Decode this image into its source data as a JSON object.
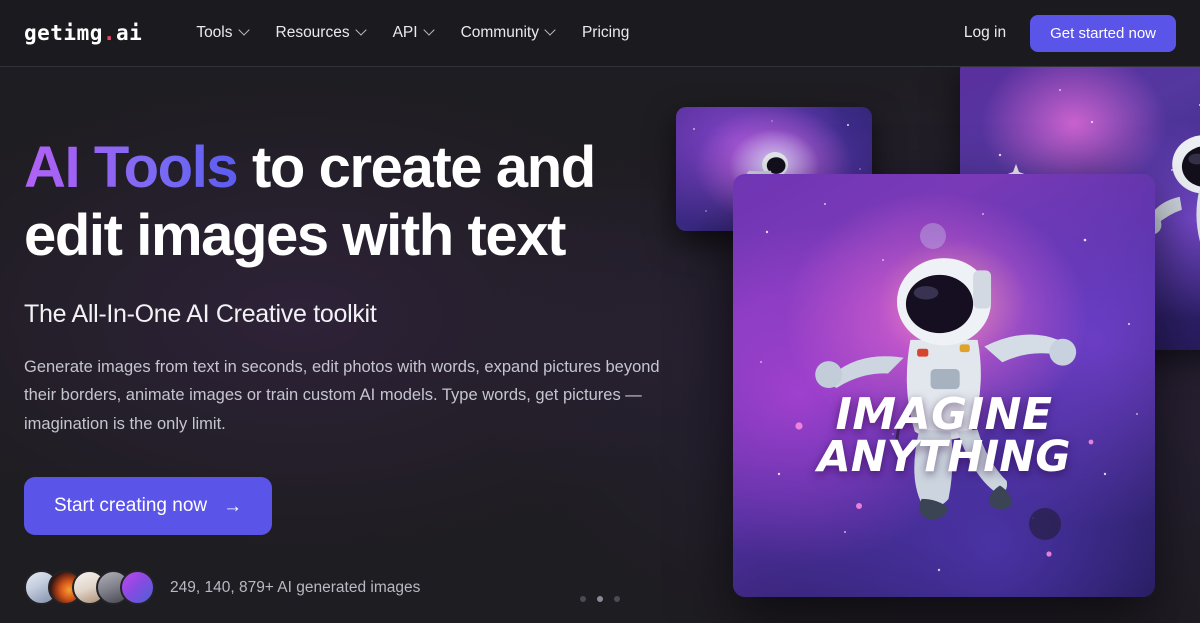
{
  "navbar": {
    "logo": {
      "text": "getimg",
      "dot": ".",
      "suffix": "ai",
      "full": "getimg.ai"
    },
    "links": [
      {
        "label": "Tools",
        "has_chevron": true,
        "icon": "chevron-down-icon"
      },
      {
        "label": "Resources",
        "has_chevron": true,
        "icon": "chevron-down-icon"
      },
      {
        "label": "API",
        "has_chevron": true,
        "icon": "chevron-down-icon"
      },
      {
        "label": "Community",
        "has_chevron": true,
        "icon": "chevron-down-icon"
      },
      {
        "label": "Pricing",
        "has_chevron": false,
        "icon": ""
      }
    ],
    "login_label": "Log in",
    "get_started_label": "Get started now"
  },
  "hero": {
    "headline_highlight": "AI Tools",
    "headline_rest": " to create and edit images with text",
    "subheadline": "The All-In-One AI Creative toolkit",
    "body": "Generate images from text in seconds, edit photos with words, expand pictures beyond their borders, animate images or train custom AI models. Type words, get pictures — imagination is the only limit.",
    "cta_label": "Start creating now",
    "cta_arrow": "→",
    "counter_text": "249, 140, 879+ AI generated images",
    "avatars": [
      {
        "name": "avatar-1",
        "colors": [
          "#dfe4ee",
          "#9aa8c2"
        ]
      },
      {
        "name": "avatar-2",
        "colors": [
          "#2a1410",
          "#e4701f"
        ]
      },
      {
        "name": "avatar-3",
        "colors": [
          "#f2efeb",
          "#b89b86"
        ]
      },
      {
        "name": "avatar-4",
        "colors": [
          "#9b9ba2",
          "#4e4e58"
        ]
      },
      {
        "name": "avatar-5",
        "colors": [
          "#b145e8",
          "#4f63d8"
        ]
      }
    ]
  },
  "cards": {
    "top": {
      "name": "astronaut-nebula-card-small",
      "alt": "Astronaut floating in a purple nebula vortex"
    },
    "right": {
      "name": "astronaut-nebula-card-right",
      "alt": "Astronaut reaching out in a pink and blue nebula"
    },
    "main": {
      "name": "imagine-anything-card",
      "alt": "Astronaut with arms outstretched in a magenta nebula",
      "caption_line1": "IMAGINE",
      "caption_line2": "ANYTHING"
    }
  },
  "carousel": {
    "dots": 3,
    "active_index": 1
  },
  "colors": {
    "background": "#1e1d21",
    "navbar_background": "#1b1b1f",
    "accent_purple": "#5b54e8",
    "logo_dot": "#ef4466",
    "gradient_start": "#b163f5",
    "gradient_end": "#5b5cf0",
    "body_text": "#c5c5cf",
    "muted_text": "#b9b9c6"
  }
}
